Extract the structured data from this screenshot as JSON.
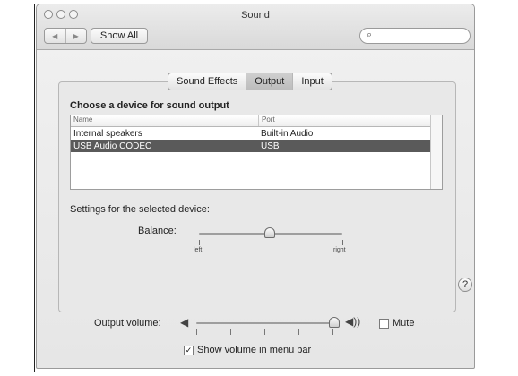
{
  "window": {
    "title": "Sound"
  },
  "toolbar": {
    "show_all_label": "Show All",
    "search_placeholder": ""
  },
  "tabs": {
    "sound_effects": "Sound Effects",
    "output": "Output",
    "input": "Input"
  },
  "output_panel": {
    "choose_label": "Choose a device for sound output",
    "columns": [
      "Name",
      "Port"
    ],
    "devices": [
      {
        "name": "Internal speakers",
        "port": "Built-in Audio",
        "selected": false
      },
      {
        "name": "USB Audio CODEC",
        "port": "USB",
        "selected": true
      }
    ],
    "settings_label": "Settings for the selected device:",
    "balance_label": "Balance:",
    "balance_left_label": "left",
    "balance_right_label": "right",
    "balance_value": 0.48
  },
  "footer": {
    "output_volume_label": "Output volume:",
    "mute_label": "Mute",
    "show_volume_label": "Show volume in menu bar",
    "output_volume_value": 0.96,
    "mute_checked": false,
    "show_volume_checked": true,
    "help_label": "?"
  },
  "icons": {
    "back": "◀",
    "forward": "▶",
    "search": "⌕",
    "speaker_low": "◀",
    "speaker_high": "◀))",
    "checkmark": "✓"
  }
}
